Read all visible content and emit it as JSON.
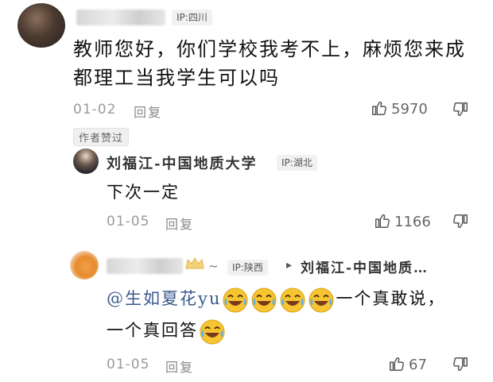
{
  "comment1": {
    "ip": "IP:四川",
    "text_line1": "教师您好，你们学校我考不上，麻烦您来成",
    "text_line2": "都理工当我学生可以吗",
    "date": "01-02",
    "reply_label": "回复",
    "like_count": "5970",
    "author_liked_label": "作者赞过"
  },
  "reply1": {
    "author": "刘福江-中国地质大学",
    "ip": "IP:湖北",
    "text": "下次一定",
    "date": "01-05",
    "reply_label": "回复",
    "like_count": "1166"
  },
  "reply2": {
    "name_suffix": "~",
    "ip": "IP:陕西",
    "reply_to_arrow": "▸",
    "reply_to": "刘福江-中国地质…",
    "mention": "@生如夏花yu",
    "text_after_emojis": "一个真敢说，",
    "text_line2": "一个真回答",
    "emoji_name": "laughing-crying-emoji",
    "date": "01-05",
    "reply_label": "回复",
    "like_count": "67"
  },
  "colors": {
    "mention": "#3a5a8c",
    "emoji_face": "#f7c531"
  }
}
